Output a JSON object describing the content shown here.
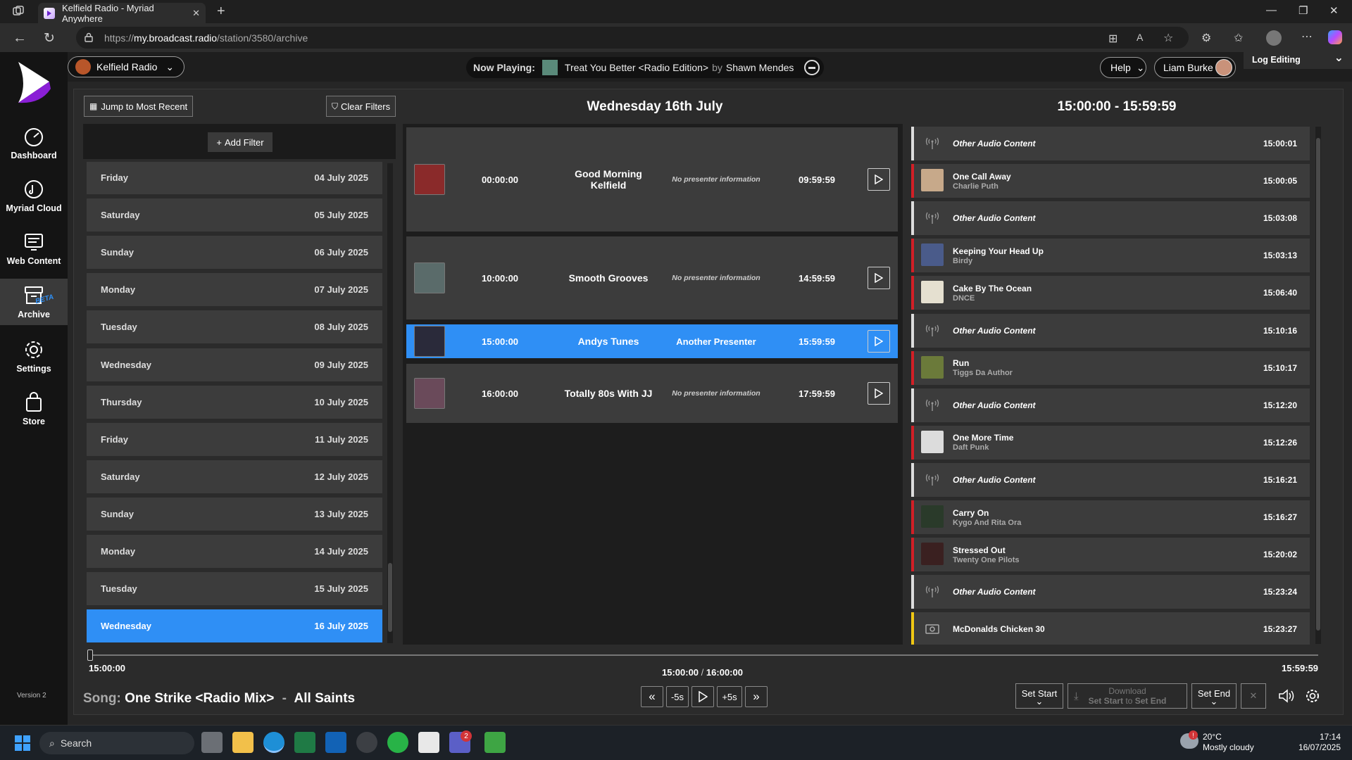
{
  "browser": {
    "tab_title": "Kelfield Radio - Myriad Anywhere",
    "url_prefix": "https://",
    "url_host": "my.broadcast.radio",
    "url_path": "/station/3580/archive"
  },
  "nav": {
    "items": [
      {
        "label": "Dashboard"
      },
      {
        "label": "Myriad Cloud"
      },
      {
        "label": "Web Content"
      },
      {
        "label": "Archive",
        "badge": "BETA"
      },
      {
        "label": "Settings"
      },
      {
        "label": "Store"
      }
    ],
    "version": "Version 2"
  },
  "topbar": {
    "station": "Kelfield Radio",
    "now_playing_label": "Now Playing:",
    "now_playing_track": "Treat You Better <Radio Edition>",
    "now_playing_by": "by",
    "now_playing_artist": "Shawn Mendes",
    "help": "Help",
    "user": "Liam Burke",
    "log_editing": "Log Editing"
  },
  "archive": {
    "jump_label": "Jump to Most Recent",
    "clear_label": "Clear Filters",
    "add_filter_label": "Add Filter",
    "date_header": "Wednesday 16th July",
    "range_header": "15:00:00 - 15:59:59",
    "days": [
      {
        "day": "Friday",
        "date": "04 July 2025"
      },
      {
        "day": "Saturday",
        "date": "05 July 2025"
      },
      {
        "day": "Sunday",
        "date": "06 July 2025"
      },
      {
        "day": "Monday",
        "date": "07 July 2025"
      },
      {
        "day": "Tuesday",
        "date": "08 July 2025"
      },
      {
        "day": "Wednesday",
        "date": "09 July 2025"
      },
      {
        "day": "Thursday",
        "date": "10 July 2025"
      },
      {
        "day": "Friday",
        "date": "11 July 2025"
      },
      {
        "day": "Saturday",
        "date": "12 July 2025"
      },
      {
        "day": "Sunday",
        "date": "13 July 2025"
      },
      {
        "day": "Monday",
        "date": "14 July 2025"
      },
      {
        "day": "Tuesday",
        "date": "15 July 2025"
      },
      {
        "day": "Wednesday",
        "date": "16 July 2025"
      }
    ],
    "shows": [
      {
        "start": "00:00:00",
        "name": "Good Morning Kelfield",
        "presenter": "No presenter information",
        "end": "09:59:59"
      },
      {
        "start": "10:00:00",
        "name": "Smooth Grooves",
        "presenter": "No presenter information",
        "end": "14:59:59"
      },
      {
        "start": "15:00:00",
        "name": "Andys Tunes",
        "presenter": "Another Presenter",
        "end": "15:59:59"
      },
      {
        "start": "16:00:00",
        "name": "Totally 80s With JJ",
        "presenter": "No presenter information",
        "end": "17:59:59"
      }
    ],
    "log": [
      {
        "title": "Other Audio Content",
        "artist": "",
        "time": "15:00:01",
        "kind": "other"
      },
      {
        "title": "One Call Away",
        "artist": "Charlie Puth",
        "time": "15:00:05",
        "kind": "song"
      },
      {
        "title": "Other Audio Content",
        "artist": "",
        "time": "15:03:08",
        "kind": "other"
      },
      {
        "title": "Keeping Your Head Up",
        "artist": "Birdy",
        "time": "15:03:13",
        "kind": "song"
      },
      {
        "title": "Cake By The Ocean",
        "artist": "DNCE",
        "time": "15:06:40",
        "kind": "song"
      },
      {
        "title": "Other Audio Content",
        "artist": "",
        "time": "15:10:16",
        "kind": "other"
      },
      {
        "title": "Run",
        "artist": "Tiggs Da Author",
        "time": "15:10:17",
        "kind": "song"
      },
      {
        "title": "Other Audio Content",
        "artist": "",
        "time": "15:12:20",
        "kind": "other"
      },
      {
        "title": "One More Time",
        "artist": "Daft Punk",
        "time": "15:12:26",
        "kind": "song"
      },
      {
        "title": "Other Audio Content",
        "artist": "",
        "time": "15:16:21",
        "kind": "other"
      },
      {
        "title": "Carry On",
        "artist": "Kygo And Rita Ora",
        "time": "15:16:27",
        "kind": "song"
      },
      {
        "title": "Stressed Out",
        "artist": "Twenty One Pilots",
        "time": "15:20:02",
        "kind": "song"
      },
      {
        "title": "Other Audio Content",
        "artist": "",
        "time": "15:23:24",
        "kind": "other"
      },
      {
        "title": "McDonalds Chicken 30",
        "artist": "",
        "time": "15:23:27",
        "kind": "ad"
      }
    ]
  },
  "player": {
    "start_time": "15:00:00",
    "current": "15:00:00",
    "separator": "/",
    "total": "16:00:00",
    "end_time": "15:59:59",
    "song_label": "Song:",
    "song_title": "One Strike <Radio Mix>",
    "song_dash": "-",
    "song_artist": "All Saints",
    "back5": "-5s",
    "fwd5": "+5s",
    "set_start": "Set Start",
    "download": "Download",
    "dl_from": "Set Start",
    "dl_to": "to",
    "dl_end": "Set End",
    "set_end": "Set End"
  },
  "taskbar": {
    "search": "Search",
    "teams_badge": "2",
    "weather_temp": "20°C",
    "weather_desc": "Mostly cloudy",
    "time": "17:14",
    "date": "16/07/2025",
    "weather_badge": "!"
  }
}
